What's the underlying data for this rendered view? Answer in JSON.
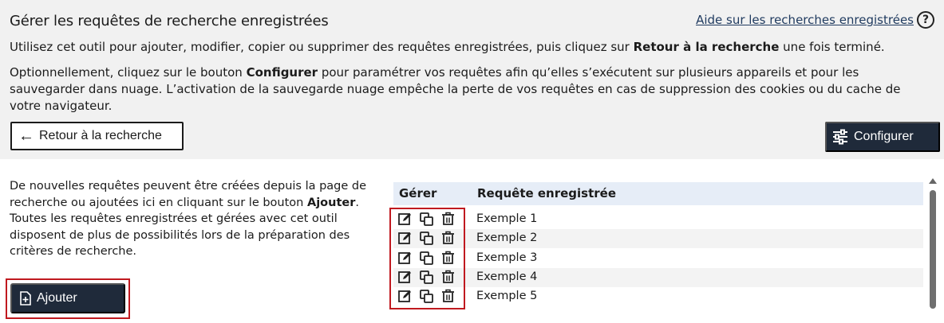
{
  "header": {
    "title": "Gérer les requêtes de recherche enregistrées",
    "help_link": "Aide sur les recherches enregistrées",
    "help_icon": "question-circle-icon"
  },
  "description": {
    "line1_part1": "Utilisez cet outil pour ajouter, modifier, copier ou supprimer des requêtes enregistrées, puis cliquez sur ",
    "line1_bold": "Retour à la recherche",
    "line1_part2": " une fois terminé.",
    "line2_part1": "Optionnellement, cliquez sur le bouton ",
    "line2_bold": "Configurer",
    "line2_part2": " pour paramétrer vos requêtes afin qu’elles s’exécutent sur plusieurs appareils et pour les sauvegarder dans nuage. L’activation de la sauvegarde nuage empêche la perte de vos requêtes en cas de suppression des cookies ou du cache de votre navigateur."
  },
  "toolbar": {
    "back_label": "Retour à la recherche",
    "back_icon": "arrow-left-icon",
    "configure_label": "Configurer",
    "configure_icon": "sliders-icon"
  },
  "side_text": {
    "part1": "De nouvelles requêtes peuvent être créées depuis la page de recherche ou ajoutées ici en cliquant sur le bouton ",
    "bold": "Ajouter",
    "part2": ". Toutes les requêtes enregistrées et gérées avec cet outil disposent de plus de possibilités lors de la préparation des critères de recherche."
  },
  "add_button": {
    "label": "Ajouter",
    "icon": "file-plus-icon"
  },
  "table": {
    "headers": {
      "manage": "Gérer",
      "query": "Requête enregistrée"
    },
    "action_icons": [
      "edit-icon",
      "copy-icon",
      "trash-icon"
    ],
    "rows": [
      {
        "label": "Exemple 1"
      },
      {
        "label": "Exemple 2"
      },
      {
        "label": "Exemple 3"
      },
      {
        "label": "Exemple 4"
      },
      {
        "label": "Exemple 5"
      }
    ]
  },
  "colors": {
    "panel_bg": "#f1f1f1",
    "button_dark": "#1f2a3a",
    "highlight_red": "#c0191f",
    "table_header_bg": "#e6edf7"
  }
}
